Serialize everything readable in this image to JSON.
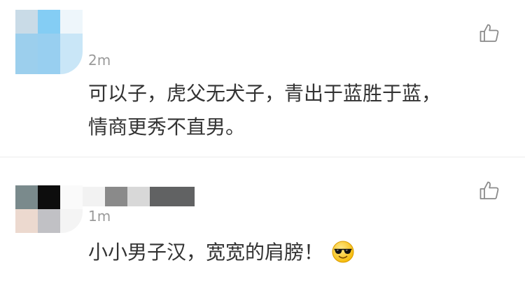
{
  "comments": [
    {
      "time": "2m",
      "lines": [
        "可以子，虎父无犬子，青出于蓝胜于蓝，",
        "情商更秀不直男。"
      ],
      "avatar_colors": [
        "#c9dbe7",
        "#84cdf4",
        "#ffffff",
        "#9ccfed",
        "#98cff0",
        "#c9e6f7"
      ]
    },
    {
      "time": "1m",
      "text": "小小男子汉，宽宽的肩膀！",
      "avatar_colors": [
        "#7a8a8c",
        "#0d0d0d",
        "#ffffff",
        "#ecd9cf",
        "#c1c1c5",
        "#ffffff"
      ],
      "name_block_colors": [
        "#f2f2f2",
        "#8a8a8a",
        "#d8d8d8",
        "#616263"
      ],
      "emoji": "sunglasses-face"
    }
  ],
  "icons": {
    "like": "thumbs-up-icon"
  },
  "colors": {
    "time": "#9a9a9a",
    "text": "#333333",
    "divider": "#ececec"
  }
}
